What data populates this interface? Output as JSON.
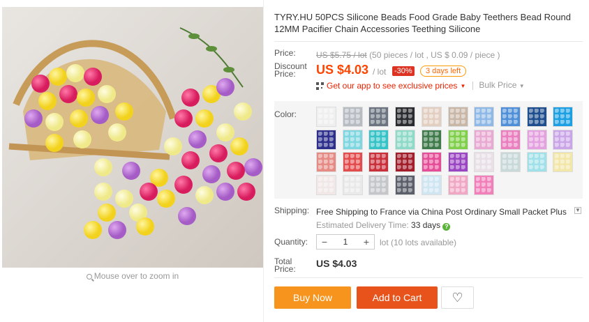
{
  "product": {
    "title": "TYRY.HU 50PCS Silicone Beads Food Grade Baby Teethers Bead Round 12MM Pacifier Chain Accessories Teething Silicone"
  },
  "gallery": {
    "zoom_hint": "Mouse over to zoom in",
    "bead_colors": [
      "#f6d62a",
      "#e32d6e",
      "#b86fd1",
      "#f2ee8e",
      "#d9d9d9"
    ]
  },
  "price": {
    "label": "Price:",
    "original": "US $5.75 / lot",
    "original_detail": "(50 pieces / lot , US $ 0.09 / piece )",
    "discount_label": "Discount Price:",
    "discount_value": "US $4.03",
    "per_lot": "/ lot",
    "discount_badge": "-30%",
    "days_left": "3 days left",
    "app_promo": "Get our app to see exclusive prices",
    "bulk_price": "Bulk Price"
  },
  "color": {
    "label": "Color:",
    "swatches": [
      "#efefef",
      "#b7bcc2",
      "#6b7480",
      "#2a2b2f",
      "#e2cfc1",
      "#c8b6a6",
      "#8eb8e6",
      "#4f8fd8",
      "#1f4e8f",
      "#1ca0e3",
      "#2e2f8c",
      "#7ed6e0",
      "#35c3c7",
      "#8ed9c7",
      "#3f7a4a",
      "#7fcf4a",
      "#e8a9d2",
      "#e97fbf",
      "#e3a1df",
      "#caa6e9",
      "#e68a84",
      "#e34c4c",
      "#c9303a",
      "#a31c2a",
      "#e54d98",
      "#9a45c2",
      "#e8e0e6",
      "#c9d9d9",
      "#a0e0e8",
      "#f2e6a8",
      "#f1e7e7",
      "#e9e9e9",
      "#c4c6ca",
      "#5a5f6a",
      "#cfe6f2",
      "#f0a7c4",
      "#f07fba"
    ],
    "selected_index": 39
  },
  "shipping": {
    "label": "Shipping:",
    "text": "Free Shipping to France via China Post Ordinary Small Packet Plus",
    "delivery_label": "Estimated Delivery Time:",
    "delivery_days": "33 days"
  },
  "quantity": {
    "label": "Quantity:",
    "minus": "−",
    "value": "1",
    "plus": "+",
    "note": "lot (10 lots available)"
  },
  "total": {
    "label": "Total Price:",
    "value": "US $4.03"
  },
  "actions": {
    "buy_now": "Buy Now",
    "add_to_cart": "Add to Cart",
    "wishlist_icon": "heart-icon"
  }
}
